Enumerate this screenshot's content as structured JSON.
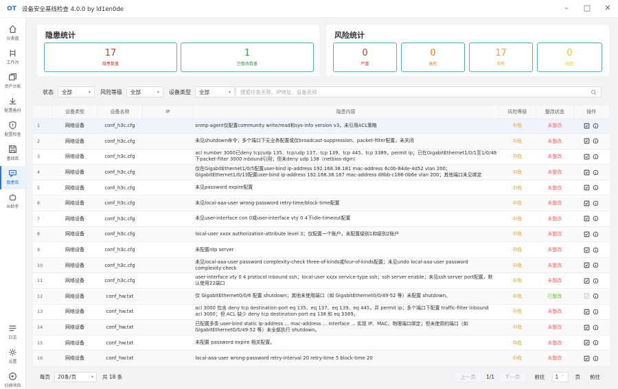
{
  "window": {
    "logo": "OT",
    "title": "设备安全基线检查 4.0.0 by ld1en0de",
    "controls": [
      "–",
      "□",
      "✕"
    ]
  },
  "sidebar": {
    "items": [
      {
        "label": "仪表盘",
        "icon": "home-icon"
      },
      {
        "label": "工作台",
        "icon": "toolbox-icon"
      },
      {
        "label": "资产台账",
        "icon": "assets-icon"
      },
      {
        "label": "配置备份",
        "icon": "download-icon"
      },
      {
        "label": "配置检查",
        "icon": "shield-icon"
      },
      {
        "label": "基线库",
        "icon": "save-icon"
      },
      {
        "label": "隐患库",
        "icon": "chat-icon"
      },
      {
        "label": "AI助手",
        "icon": "robot-icon"
      }
    ],
    "bottom_items": [
      {
        "label": "日志",
        "icon": "menu-icon"
      },
      {
        "label": "设置",
        "icon": "gear-icon"
      },
      {
        "label": "切换项目",
        "icon": "switch-icon"
      }
    ]
  },
  "hazard_stats": {
    "title": "隐患统计",
    "cards": [
      {
        "value": "17",
        "label": "隐患数量",
        "color": "#c0392b"
      },
      {
        "value": "1",
        "label": "已整改数量",
        "color": "#2e9e3e"
      }
    ]
  },
  "risk_stats": {
    "title": "风险统计",
    "cards": [
      {
        "value": "0",
        "label": "严重",
        "color": "#c0392b"
      },
      {
        "value": "0",
        "label": "高危",
        "color": "#e67e22"
      },
      {
        "value": "17",
        "label": "中危",
        "color": "#e6a23c"
      },
      {
        "value": "0",
        "label": "低危",
        "color": "#f5c518"
      }
    ]
  },
  "filters": {
    "status_label": "状态",
    "status_value": "全部",
    "risk_label": "风险等级",
    "risk_value": "全部",
    "devtype_label": "设备类型",
    "devtype_value": "全部",
    "search_placeholder": "搜索任务名称、IP地址、设备名称"
  },
  "table": {
    "headers": [
      "",
      "设备类型",
      "设备名称",
      "IP",
      "隐患内容",
      "风险等级",
      "整改状态",
      "操作"
    ],
    "rows": [
      {
        "idx": "1",
        "type": "网络设备",
        "name": "conf_h3c.cfg",
        "ip": "",
        "issue": "snmp-agent仅配置community write/read和sys-info version v3，未引用ACL策略",
        "risk": "中危",
        "status": "未整改"
      },
      {
        "idx": "2",
        "type": "网络设备",
        "name": "conf_h3c.cfg",
        "ip": "",
        "issue": "未见shutdown命令；多个端口下无业务配置或仅broadcast-suppression、packet-filter配置，未关闭",
        "risk": "中危",
        "status": "未整改"
      },
      {
        "idx": "3",
        "type": "网络设备",
        "name": "conf_h3c.cfg",
        "ip": "",
        "issue": "acl number 3000已deny tcp/udp 135、tcp/udp 137、tcp 139、tcp 445、tcp 3389，permit ip；已在GigabitEthernet1/0/1至1/0/48下packet-filter 3000 inbound引用；但未deny udp 138（netbios-dgm）",
        "risk": "中危",
        "status": "未整改"
      },
      {
        "idx": "4",
        "type": "网络设备",
        "name": "conf_h3c.cfg",
        "ip": "",
        "issue": "仅在GigabitEthernet1/0/5配置user-bind ip-address 192.168.38.181 mac-address 6c0b-84de-4d52 vlan 200；GigabitEthernet1/0/13配置user-bind ip-address 192.168.38.167 mac-address d8bb-c186-0b6e vlan 200；其他端口未见绑定",
        "risk": "中危",
        "status": "未整改"
      },
      {
        "idx": "5",
        "type": "网络设备",
        "name": "conf_h3c.cfg",
        "ip": "",
        "issue": "未见password expire配置",
        "risk": "中危",
        "status": "未整改"
      },
      {
        "idx": "6",
        "type": "网络设备",
        "name": "conf_h3c.cfg",
        "ip": "",
        "issue": "未见local-aaa-user wrong-password retry-time/block-time配置",
        "risk": "中危",
        "status": "未整改"
      },
      {
        "idx": "7",
        "type": "网络设备",
        "name": "conf_h3c.cfg",
        "ip": "",
        "issue": "未见user-interface con 0或user-interface vty 0 4下idle-timeout配置",
        "risk": "中危",
        "status": "未整改"
      },
      {
        "idx": "8",
        "type": "网络设备",
        "name": "conf_h3c.cfg",
        "ip": "",
        "issue": "local-user xxzx authorization-attribute level 3；仅配置一个账户，未配置级别1和级别2账户",
        "risk": "中危",
        "status": "未整改"
      },
      {
        "idx": "9",
        "type": "网络设备",
        "name": "conf_h3c.cfg",
        "ip": "",
        "issue": "未配置ntp server",
        "risk": "中危",
        "status": "未整改"
      },
      {
        "idx": "10",
        "type": "网络设备",
        "name": "conf_h3c.cfg",
        "ip": "",
        "issue": "未见local-aaa-user password complexity-check three-of-kinds或four-of-kinds配置；未见undo local-aaa-user password complexity-check",
        "risk": "中危",
        "status": "未整改"
      },
      {
        "idx": "11",
        "type": "网络设备",
        "name": "conf_h3c.cfg",
        "ip": "",
        "issue": "user-interface vty 0 4 protocol inbound ssh；local-user xxzx service-type ssh；ssh server enable；未见ssh server port配置，默认使用22端口",
        "risk": "中危",
        "status": "未整改"
      },
      {
        "idx": "12",
        "type": "网络设备",
        "name": "conf_hw.txt",
        "ip": "",
        "issue": "仅 GigabitEthernet0/0/6 配置 shutdown；其他未使用端口（如 GigabitEthernet0/0/49-52 等）未配置 shutdown。",
        "risk": "中危",
        "status": "已整改"
      },
      {
        "idx": "13",
        "type": "网络设备",
        "name": "conf_hw.txt",
        "ip": "",
        "issue": "acl 3000 包含 deny tcp destination-port eq 135、eq 137、eq 139、eq 445，并 permit ip；多个端口下配置 traffic-filter inbound acl 3000；但 ACL 缺少 deny tcp destination-port eq 138 和 eq 3389。",
        "risk": "中危",
        "status": "未整改"
      },
      {
        "idx": "14",
        "type": "网络设备",
        "name": "conf_hw.txt",
        "ip": "",
        "issue": "已配置多条 user-bind static ip-address ... mac-address ... interface ... 实现 IP、MAC、物理端口绑定；但未使用的端口（如 GigabitEthernet0/0/49-52 等）未全部执行 shutdown。",
        "risk": "中危",
        "status": "未整改"
      },
      {
        "idx": "15",
        "type": "网络设备",
        "name": "conf_hw.txt",
        "ip": "",
        "issue": "未配置 password expire 相关配置。",
        "risk": "中危",
        "status": "未整改"
      },
      {
        "idx": "16",
        "type": "网络设备",
        "name": "conf_hw.txt",
        "ip": "",
        "issue": "local-aaa-user wrong-password retry-interval 20 retry-time 5 block-time 20",
        "risk": "中危",
        "status": "未整改"
      }
    ]
  },
  "pager": {
    "per_page_label": "每页",
    "per_page_value": "20条/页",
    "total": "共 18 条",
    "prev": "上一页",
    "page_info": "1/1",
    "next": "下一页",
    "goto_label": "前往",
    "goto_value": "1",
    "page_unit": "页",
    "goto_button": "前往"
  }
}
